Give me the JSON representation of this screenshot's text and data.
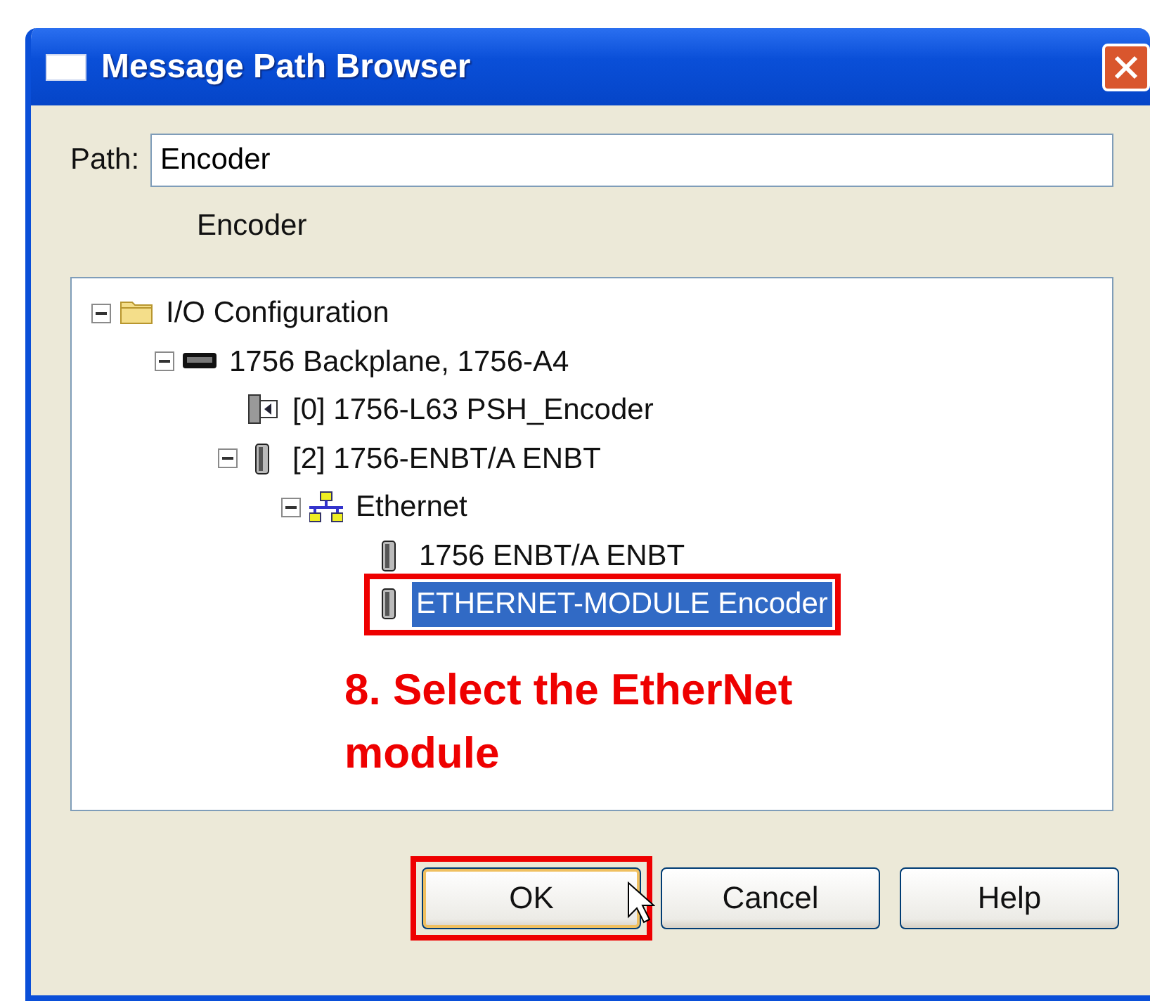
{
  "window": {
    "title": "Message Path Browser"
  },
  "path": {
    "label": "Path:",
    "value": "Encoder"
  },
  "resolved_path": "Encoder",
  "tree": [
    {
      "label": "I/O Configuration",
      "kind": "folder",
      "expanded": true,
      "selected": false,
      "highlighted": false,
      "children": [
        {
          "label": "1756 Backplane, 1756-A4",
          "kind": "backplane",
          "expanded": true,
          "selected": false,
          "highlighted": false,
          "children": [
            {
              "label": "[0] 1756-L63 PSH_Encoder",
              "kind": "controller",
              "selected": false,
              "highlighted": false
            },
            {
              "label": "[2] 1756-ENBT/A ENBT",
              "kind": "module",
              "expanded": true,
              "selected": false,
              "highlighted": false,
              "children": [
                {
                  "label": "Ethernet",
                  "kind": "network",
                  "expanded": true,
                  "selected": false,
                  "highlighted": false,
                  "children": [
                    {
                      "label": "1756 ENBT/A ENBT",
                      "kind": "module",
                      "selected": false,
                      "highlighted": false
                    },
                    {
                      "label": "ETHERNET-MODULE Encoder",
                      "kind": "module",
                      "selected": true,
                      "highlighted": true
                    }
                  ]
                }
              ]
            }
          ]
        }
      ]
    }
  ],
  "callout": "8. Select the EtherNet module",
  "buttons": [
    {
      "label": "OK",
      "default": true,
      "highlighted": true
    },
    {
      "label": "Cancel",
      "default": false,
      "highlighted": false
    },
    {
      "label": "Help",
      "default": false,
      "highlighted": false
    }
  ]
}
